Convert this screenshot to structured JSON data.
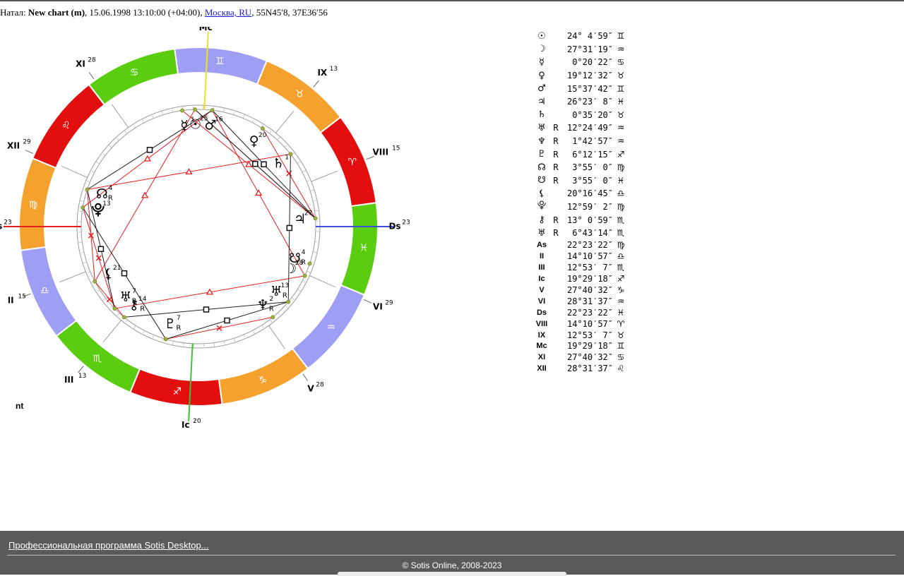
{
  "header": {
    "prefix": "Натал:",
    "chart_name": "New chart (m)",
    "datetime": ", 15.06.1998 13:10:00 (+04:00), ",
    "location_link": "Москва, RU",
    "coords": ", 55N45′8, 37E36′56"
  },
  "wheel": {
    "zodiac_colors": {
      "fire": "#e30f0f",
      "earth": "#f5a12d",
      "air": "#9f9ef5",
      "water": "#5acd10"
    },
    "zodiac": [
      {
        "name": "aries",
        "glyph": "♈",
        "element": "fire"
      },
      {
        "name": "taurus",
        "glyph": "♉",
        "element": "earth"
      },
      {
        "name": "gemini",
        "glyph": "♊",
        "element": "air"
      },
      {
        "name": "cancer",
        "glyph": "♋",
        "element": "water"
      },
      {
        "name": "leo",
        "glyph": "♌",
        "element": "fire"
      },
      {
        "name": "virgo",
        "glyph": "♍",
        "element": "earth"
      },
      {
        "name": "libra",
        "glyph": "♎",
        "element": "air"
      },
      {
        "name": "scorpio",
        "glyph": "♏",
        "element": "water"
      },
      {
        "name": "sagittarius",
        "glyph": "♐",
        "element": "fire"
      },
      {
        "name": "capricorn",
        "glyph": "♑",
        "element": "earth"
      },
      {
        "name": "aquarius",
        "glyph": "♒",
        "element": "air"
      },
      {
        "name": "pisces",
        "glyph": "♓",
        "element": "water"
      }
    ],
    "houses": [
      {
        "label": "As",
        "deg": "23",
        "lon": 172.37
      },
      {
        "label": "II",
        "deg": "15",
        "lon": 194.18
      },
      {
        "label": "III",
        "deg": "13",
        "lon": 222.88
      },
      {
        "label": "Ic",
        "deg": "20",
        "lon": 259.49
      },
      {
        "label": "V",
        "deg": "28",
        "lon": 297.68
      },
      {
        "label": "VI",
        "deg": "29",
        "lon": 328.53
      },
      {
        "label": "Ds",
        "deg": "23",
        "lon": 352.37
      },
      {
        "label": "VIII",
        "deg": "15",
        "lon": 14.18
      },
      {
        "label": "IX",
        "deg": "13",
        "lon": 42.88
      },
      {
        "label": "Mc",
        "deg": "20",
        "lon": 79.49
      },
      {
        "label": "XI",
        "deg": "28",
        "lon": 117.68
      },
      {
        "label": "XII",
        "deg": "29",
        "lon": 148.53
      }
    ],
    "planets": [
      {
        "name": "sun",
        "glyph": "☉",
        "deg": "25",
        "retro": "",
        "lon": 84.08
      },
      {
        "name": "moon",
        "glyph": "☽",
        "deg": "28",
        "retro": "",
        "lon": 327.52
      },
      {
        "name": "mercury",
        "glyph": "☿",
        "deg": "1",
        "retro": "",
        "lon": 90.34
      },
      {
        "name": "venus",
        "glyph": "♀",
        "deg": "20",
        "retro": "",
        "lon": 49.21
      },
      {
        "name": "mars",
        "glyph": "♂",
        "deg": "16",
        "retro": "",
        "lon": 75.63
      },
      {
        "name": "jupiter",
        "glyph": "♃",
        "deg": "27",
        "retro": "",
        "lon": 356.39
      },
      {
        "name": "saturn",
        "glyph": "♄",
        "deg": "1",
        "retro": "",
        "lon": 30.59
      },
      {
        "name": "uranus",
        "glyph": "♅",
        "deg": "13",
        "retro": "R",
        "lon": 312.41
      },
      {
        "name": "neptune",
        "glyph": "♆",
        "deg": "2",
        "retro": "R",
        "lon": 301.72
      },
      {
        "name": "pluto",
        "glyph": "♇",
        "deg": "7",
        "retro": "R",
        "lon": 246.2
      },
      {
        "name": "north-node",
        "glyph": "☊",
        "deg": "4",
        "retro": "R",
        "lon": 153.93
      },
      {
        "name": "south-node",
        "glyph": "☋",
        "deg": "4",
        "retro": "R",
        "lon": 333.93
      },
      {
        "name": "lilith",
        "glyph": "⚸",
        "deg": "21",
        "retro": "",
        "lon": 200.28
      },
      {
        "name": "proserpina",
        "glyph": "⯓",
        "deg": "13",
        "retro": "",
        "lon": 162.98
      },
      {
        "name": "chiron",
        "glyph": "⚷",
        "deg": "14",
        "retro": "R",
        "lon": 223.02
      },
      {
        "name": "uranus-herschel",
        "glyph": "♅",
        "deg": "7",
        "retro": "R",
        "lon": 216.73
      }
    ],
    "aspects": [
      {
        "a": "north-node",
        "b": "saturn",
        "type": "trine"
      },
      {
        "a": "proserpina",
        "b": "mars",
        "type": "trine"
      },
      {
        "a": "lilith",
        "b": "sun",
        "type": "trine"
      },
      {
        "a": "uranus-herschel",
        "b": "moon",
        "type": "trine"
      },
      {
        "a": "sun",
        "b": "jupiter",
        "type": "trine"
      },
      {
        "a": "mars",
        "b": "moon",
        "type": "trine"
      },
      {
        "a": "mercury",
        "b": "jupiter",
        "type": "trine"
      },
      {
        "a": "venus",
        "b": "jupiter",
        "type": "sextile"
      },
      {
        "a": "north-node",
        "b": "lilith",
        "type": "sextile"
      },
      {
        "a": "proserpina",
        "b": "uranus-herschel",
        "type": "sextile"
      },
      {
        "a": "pluto",
        "b": "neptune",
        "type": "sextile"
      },
      {
        "a": "chiron",
        "b": "lilith",
        "type": "sextile"
      },
      {
        "a": "north-node",
        "b": "uranus-herschel",
        "type": "square"
      },
      {
        "a": "mars",
        "b": "north-node",
        "type": "square"
      },
      {
        "a": "saturn",
        "b": "uranus",
        "type": "square"
      },
      {
        "a": "mars",
        "b": "jupiter",
        "type": "square"
      },
      {
        "a": "pluto",
        "b": "uranus",
        "type": "square"
      },
      {
        "a": "chiron",
        "b": "uranus",
        "type": "square"
      },
      {
        "a": "proserpina",
        "b": "pluto",
        "type": "square"
      },
      {
        "a": "sun",
        "b": "jupiter",
        "type": "square"
      }
    ],
    "nt_label": "nt"
  },
  "positions": [
    {
      "sym": "☉",
      "retro": "",
      "deg": "24° 4′59″",
      "sign": "♊"
    },
    {
      "sym": "☽",
      "retro": "",
      "deg": "27°31′19″",
      "sign": "♒"
    },
    {
      "sym": "☿",
      "retro": "",
      "deg": "0°20′22″",
      "sign": "♋"
    },
    {
      "sym": "♀",
      "retro": "",
      "deg": "19°12′32″",
      "sign": "♉"
    },
    {
      "sym": "♂",
      "retro": "",
      "deg": "15°37′42″",
      "sign": "♊"
    },
    {
      "sym": "♃",
      "retro": "",
      "deg": "26°23′ 8″",
      "sign": "♓"
    },
    {
      "sym": "♄",
      "retro": "",
      "deg": "0°35′20″",
      "sign": "♉"
    },
    {
      "sym": "♅",
      "retro": "R",
      "deg": "12°24′49″",
      "sign": "♒"
    },
    {
      "sym": "♆",
      "retro": "R",
      "deg": "1°42′57″",
      "sign": "♒"
    },
    {
      "sym": "♇",
      "retro": "R",
      "deg": "6°12′15″",
      "sign": "♐"
    },
    {
      "sym": "☊",
      "retro": "R",
      "deg": "3°55′ 0″",
      "sign": "♍"
    },
    {
      "sym": "☋",
      "retro": "R",
      "deg": "3°55′ 0″",
      "sign": "♓"
    },
    {
      "sym": "⚸",
      "retro": "",
      "deg": "20°16′45″",
      "sign": "♎"
    },
    {
      "sym": "⯓",
      "retro": "",
      "deg": "12°59′ 2″",
      "sign": "♍"
    },
    {
      "sym": "⚷",
      "retro": "R",
      "deg": "13° 0′59″",
      "sign": "♏"
    },
    {
      "sym": "♅",
      "retro": "R",
      "deg": "6°43′14″",
      "sign": "♏"
    },
    {
      "sym": "As",
      "retro": "",
      "deg": "22°23′22″",
      "sign": "♍",
      "house": true
    },
    {
      "sym": "II",
      "retro": "",
      "deg": "14°10′57″",
      "sign": "♎",
      "house": true
    },
    {
      "sym": "III",
      "retro": "",
      "deg": "12°53′ 7″",
      "sign": "♏",
      "house": true
    },
    {
      "sym": "Ic",
      "retro": "",
      "deg": "19°29′18″",
      "sign": "♐",
      "house": true
    },
    {
      "sym": "V",
      "retro": "",
      "deg": "27°40′32″",
      "sign": "♑",
      "house": true
    },
    {
      "sym": "VI",
      "retro": "",
      "deg": "28°31′37″",
      "sign": "♒",
      "house": true
    },
    {
      "sym": "Ds",
      "retro": "",
      "deg": "22°23′22″",
      "sign": "♓",
      "house": true
    },
    {
      "sym": "VIII",
      "retro": "",
      "deg": "14°10′57″",
      "sign": "♈",
      "house": true
    },
    {
      "sym": "IX",
      "retro": "",
      "deg": "12°53′ 7″",
      "sign": "♉",
      "house": true
    },
    {
      "sym": "Mc",
      "retro": "",
      "deg": "19°29′18″",
      "sign": "♊",
      "house": true
    },
    {
      "sym": "XI",
      "retro": "",
      "deg": "27°40′32″",
      "sign": "♋",
      "house": true
    },
    {
      "sym": "XII",
      "retro": "",
      "deg": "28°31′37″",
      "sign": "♌",
      "house": true
    }
  ],
  "footer": {
    "link": "Профессиональная программа Sotis Desktop...",
    "copyright": "© Sotis Online, 2008-2023"
  }
}
